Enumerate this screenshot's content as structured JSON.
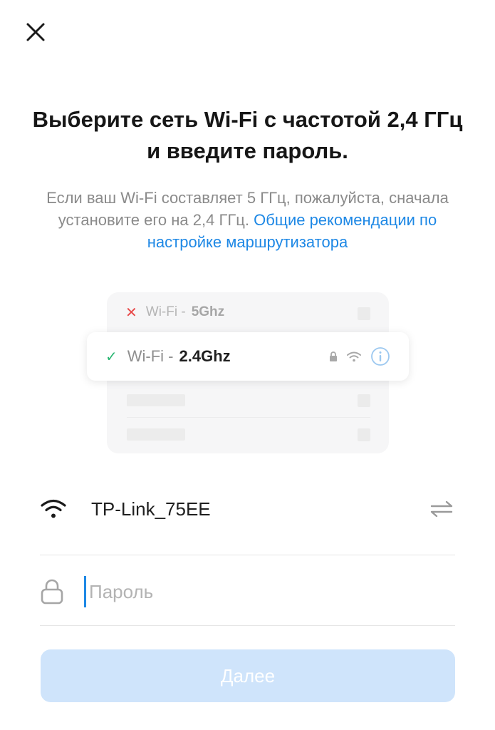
{
  "header": {
    "close_icon": "close-icon"
  },
  "title": "Выберите сеть Wi-Fi с частотой 2,4 ГГц и введите пароль.",
  "subtitle": {
    "text": "Если ваш Wi-Fi составляет 5 ГГц, пожалуйста, сначала установите его на 2,4 ГГц. ",
    "link": "Общие рекомендации по настройке маршрутизатора"
  },
  "illustration": {
    "bad_prefix": "Wi-Fi -",
    "bad_band": "5Ghz",
    "good_prefix": "Wi-Fi -",
    "good_band": "2.4Ghz",
    "icons": [
      "lock-icon",
      "wifi-icon",
      "info-icon"
    ]
  },
  "network": {
    "ssid": "TP-Link_75EE",
    "icon": "wifi-icon",
    "switch_icon": "switch-icon"
  },
  "password": {
    "placeholder": "Пароль",
    "value": ""
  },
  "next_button": {
    "label": "Далее"
  },
  "colors": {
    "accent": "#1e88e5",
    "button_disabled": "#cfe4fb",
    "check": "#2bb673",
    "cross": "#e84a4a"
  }
}
